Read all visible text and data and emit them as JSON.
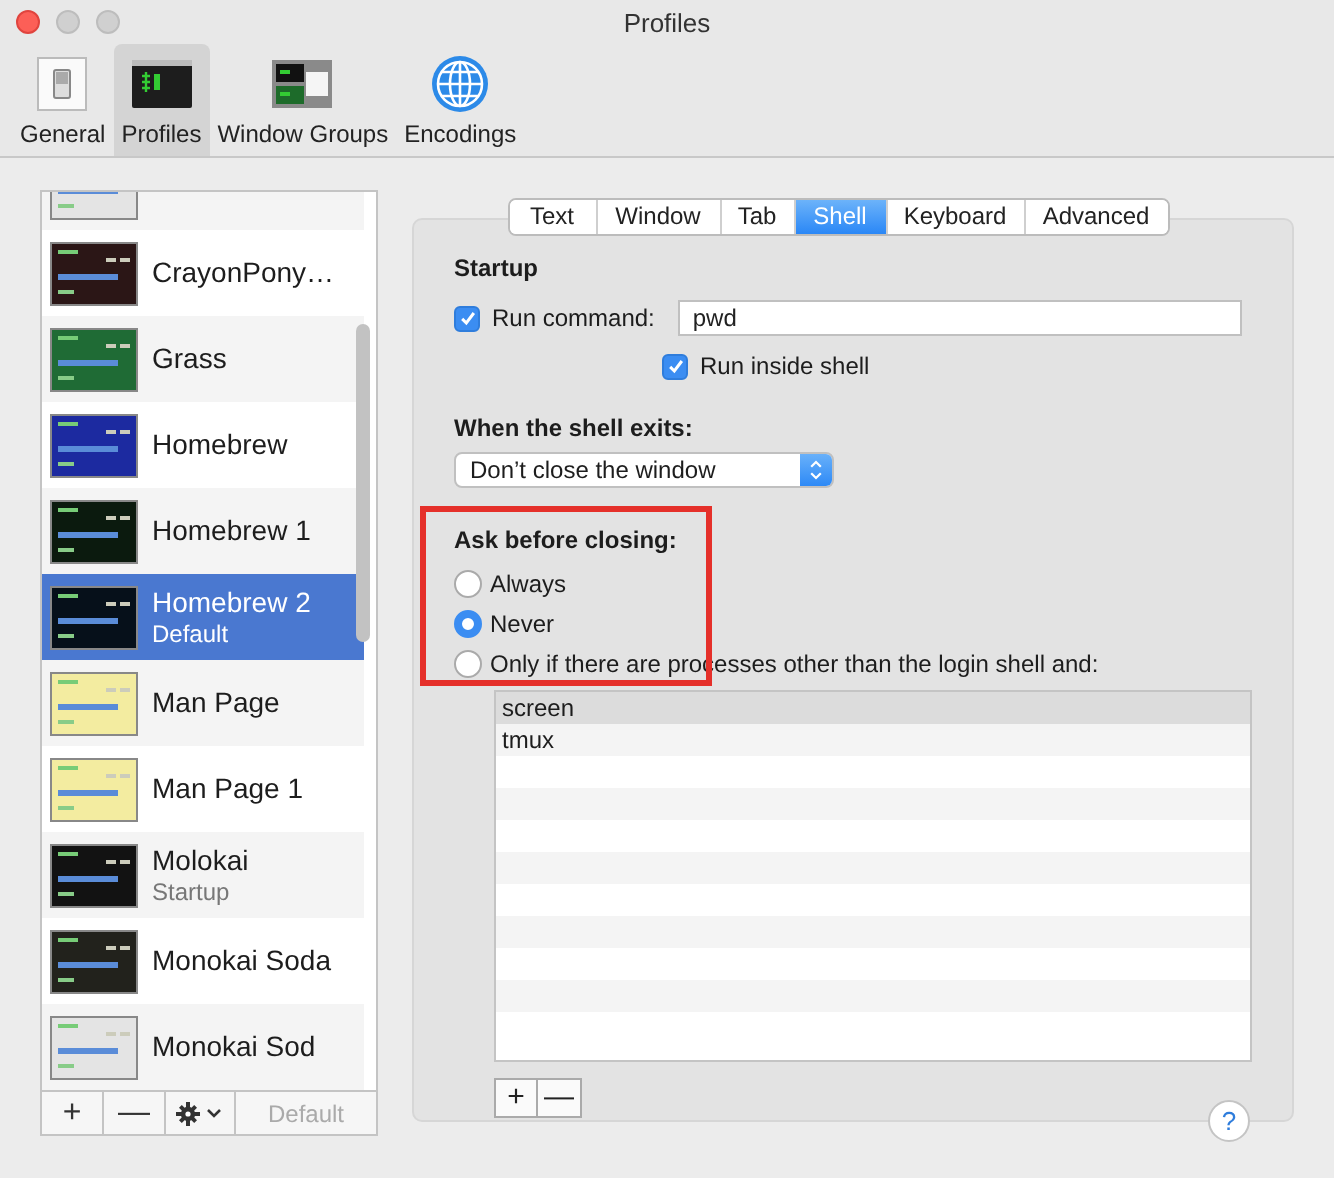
{
  "window": {
    "title": "Profiles"
  },
  "toolbar": [
    {
      "label": "General",
      "kind": "general",
      "selected": false
    },
    {
      "label": "Profiles",
      "kind": "profiles",
      "selected": true
    },
    {
      "label": "Window Groups",
      "kind": "groups",
      "selected": false
    },
    {
      "label": "Encodings",
      "kind": "encodings",
      "selected": false
    }
  ],
  "profiles": [
    {
      "color": "#e4e4e4",
      "selected": false
    },
    {
      "name": "CrayonPony…",
      "color": "#2b1616",
      "selected": false
    },
    {
      "name": "Grass",
      "color": "#1f6b35",
      "selected": false
    },
    {
      "name": "Homebrew",
      "color": "#1c2aa0",
      "selected": false
    },
    {
      "name": "Homebrew 1",
      "color": "#0b1a0e",
      "selected": false
    },
    {
      "name": "Homebrew 2",
      "subtitle": "Default",
      "color": "#06101a",
      "selected": true
    },
    {
      "name": "Man Page",
      "color": "#f3eca0",
      "selected": false
    },
    {
      "name": "Man Page 1",
      "color": "#f3eca0",
      "selected": false
    },
    {
      "name": "Molokai",
      "subtitle": "Startup",
      "color": "#121212",
      "selected": false
    },
    {
      "name": "Monokai Soda",
      "color": "#22221c",
      "selected": false
    },
    {
      "name": "Monokai Sod",
      "color": "#e4e4e4",
      "selected": false
    }
  ],
  "list_buttons": [
    {
      "label": "+",
      "kind": "text",
      "disabled": false
    },
    {
      "label": "—",
      "kind": "text",
      "disabled": false
    },
    {
      "kind": "gear",
      "disabled": false
    },
    {
      "label": "Default",
      "kind": "text",
      "disabled": true
    }
  ],
  "tabs": [
    {
      "label": "Text",
      "selected": false
    },
    {
      "label": "Window",
      "selected": false
    },
    {
      "label": "Tab",
      "selected": false
    },
    {
      "label": "Shell",
      "selected": true
    },
    {
      "label": "Keyboard",
      "selected": false
    },
    {
      "label": "Advanced",
      "selected": false
    }
  ],
  "startup": {
    "heading": "Startup",
    "run_command": {
      "label": "Run command:",
      "checked": true,
      "value": "pwd"
    },
    "run_inside_shell": {
      "label": "Run inside shell",
      "checked": true
    }
  },
  "shell_exits": {
    "heading": "When the shell exits:",
    "value": "Don’t close the window"
  },
  "ask_before_closing": {
    "heading": "Ask before closing:",
    "options": [
      {
        "label": "Always",
        "selected": false
      },
      {
        "label": "Never",
        "selected": true
      },
      {
        "label": "Only if there are processes other than the login shell and:",
        "selected": false
      }
    ]
  },
  "processes": [
    {
      "name": "screen",
      "selected": true
    },
    {
      "name": "tmux",
      "selected": false
    }
  ],
  "process_buttons": [
    "+",
    "—"
  ],
  "help_button": "?"
}
